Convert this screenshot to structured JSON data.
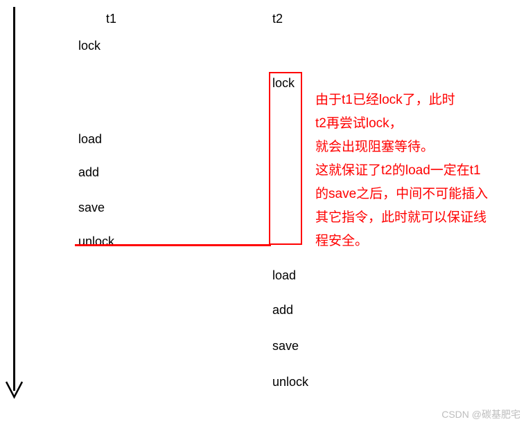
{
  "headers": {
    "t1": "t1",
    "t2": "t2"
  },
  "t1_ops": {
    "lock": "lock",
    "load": "load",
    "add": "add",
    "save": "save",
    "unlock": "unlock"
  },
  "t2_ops": {
    "lock": "lock",
    "load": "load",
    "add": "add",
    "save": "save",
    "unlock": "unlock"
  },
  "annotation": {
    "l1": "由于t1已经lock了，此时",
    "l2": "t2再尝试lock，",
    "l3": "就会出现阻塞等待。",
    "l4": "这就保证了t2的load一定在t1",
    "l5": "的save之后，中间不可能插入",
    "l6": "其它指令，此时就可以保证线",
    "l7": "程安全。"
  },
  "watermark": "CSDN @碳基肥宅"
}
